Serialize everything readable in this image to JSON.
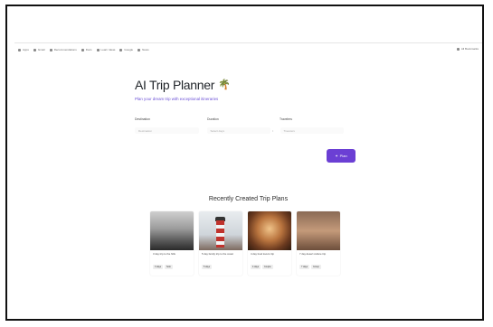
{
  "bookmarks": {
    "items": [
      {
        "label": "Apps",
        "icon": "apps-icon"
      },
      {
        "label": "Gmail",
        "icon": "gmail-icon"
      },
      {
        "label": "Recommendations",
        "icon": "bookmark-icon"
      },
      {
        "label": "Docs",
        "icon": "docs-icon"
      },
      {
        "label": "Learn Ideas",
        "icon": "bookmark-icon"
      },
      {
        "label": "Google",
        "icon": "bookmark-icon"
      },
      {
        "label": "News",
        "icon": "bookmark-icon"
      }
    ],
    "right_label": "All Bookmarks"
  },
  "hero": {
    "title": "AI Trip Planner",
    "title_icon": "palm-tree-icon",
    "subtitle": "Plan your dream trip with exceptional itineraries"
  },
  "form": {
    "labels": [
      "Destination",
      "Duration",
      "Travelers"
    ],
    "placeholders": [
      "Destination",
      "Select days",
      "Travelers"
    ],
    "submit_label": "Plan"
  },
  "recent": {
    "title": "Recently Created Trip Plans",
    "cards": [
      {
        "caption": "3 day trip to the hills",
        "tags": [
          "3 days",
          "Solo"
        ]
      },
      {
        "caption": "5 day family trip to the coast",
        "tags": [
          "5 days"
        ]
      },
      {
        "caption": "4 day food lovers trip",
        "tags": [
          "4 days",
          "Couple"
        ]
      },
      {
        "caption": "7 day desert culture trip",
        "tags": [
          "7 days",
          "Group"
        ]
      }
    ]
  },
  "colors": {
    "accent": "#6b3fd4",
    "subtitle": "#6a4fd6",
    "title": "#1f2328"
  }
}
